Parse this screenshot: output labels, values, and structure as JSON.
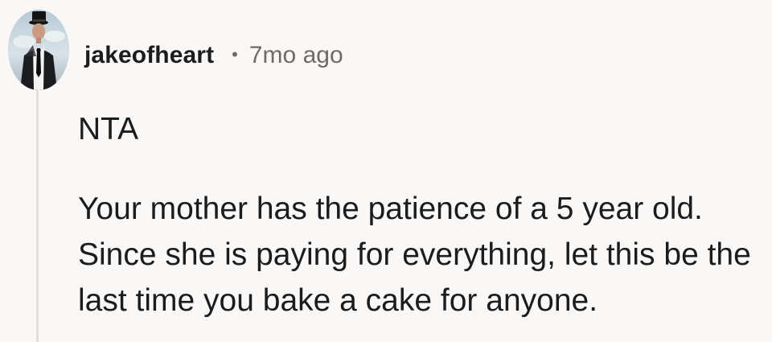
{
  "comment": {
    "author": "jakeofheart",
    "separator": "•",
    "timestamp": "7mo ago",
    "paragraphs": [
      "NTA",
      "Your mother has the patience of a 5 year old. Since she is paying for everything, let this be the last time you bake a cake for anyone."
    ]
  },
  "icons": {
    "avatar": "user-avatar-icon"
  },
  "colors": {
    "background": "#faf8f7",
    "text": "#1c1c1c",
    "muted_text": "#6f6a66",
    "thread_line": "#e2dfdb"
  }
}
